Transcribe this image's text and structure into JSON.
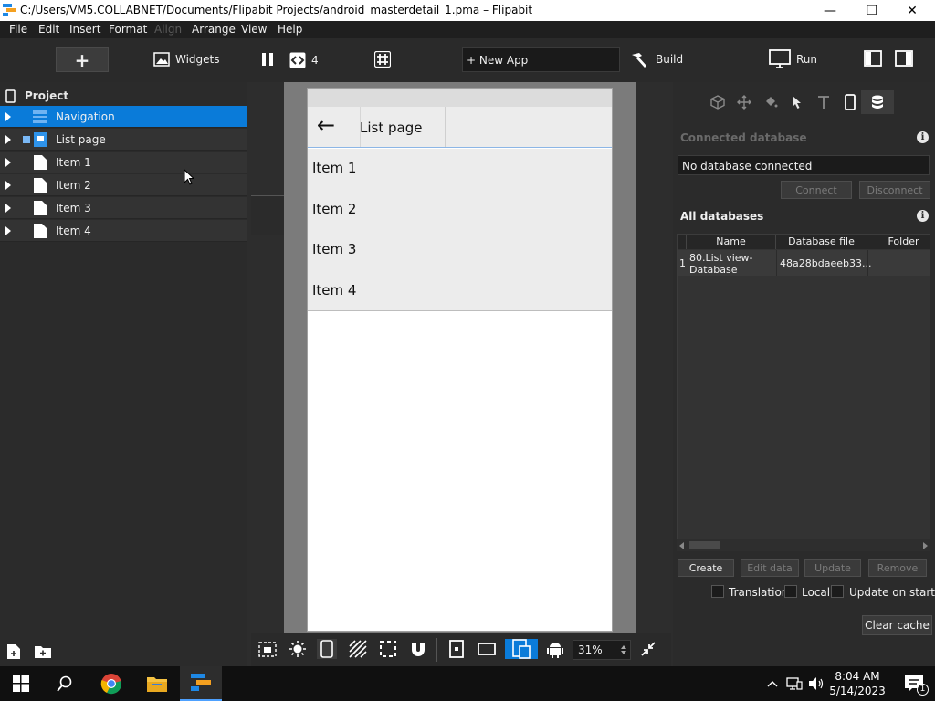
{
  "window": {
    "title": "C:/Users/VM5.COLLABNET/Documents/Flipabit Projects/android_masterdetail_1.pma – Flipabit",
    "minimize": "—",
    "restore": "❐",
    "close": "✕"
  },
  "menu": [
    "File",
    "Edit",
    "Insert",
    "Format",
    "Align",
    "Arrange",
    "View",
    "Help"
  ],
  "toolbar": {
    "add": "+",
    "widgets": "Widgets",
    "code_count": "4",
    "new_app": "+ New App",
    "build": "Build",
    "run": "Run"
  },
  "project": {
    "header": "Project",
    "items": [
      {
        "label": "Navigation",
        "icon": "navigation-icon",
        "selected": true
      },
      {
        "label": "List page",
        "icon": "page-icon",
        "selected": false
      },
      {
        "label": "Item 1",
        "icon": "document-icon",
        "selected": false
      },
      {
        "label": "Item 2",
        "icon": "document-icon",
        "selected": false
      },
      {
        "label": "Item 3",
        "icon": "document-icon",
        "selected": false
      },
      {
        "label": "Item 4",
        "icon": "document-icon",
        "selected": false
      }
    ]
  },
  "phone": {
    "appbar_title": "List page",
    "back": "←",
    "items": [
      "Item 1",
      "Item 2",
      "Item 3",
      "Item 4"
    ]
  },
  "canvas_toolbar": {
    "zoom": "31%"
  },
  "database": {
    "connected_title": "Connected database",
    "connected_value": "No database connected",
    "connect": "Connect",
    "disconnect": "Disconnect",
    "all_title": "All databases",
    "columns": [
      "Name",
      "Database file",
      "Folder"
    ],
    "rows": [
      {
        "num": "1",
        "name": "80.List view-Database",
        "file": "48a28bdaeeb33...",
        "folder": ""
      }
    ],
    "create": "Create",
    "edit_data": "Edit data",
    "update": "Update",
    "remove": "Remove",
    "translation": "Translation",
    "local": "Local",
    "update_on_startup": "Update on startup",
    "clear_cache": "Clear cache"
  },
  "taskbar": {
    "time": "8:04 AM",
    "date": "5/14/2023",
    "notifications": "1"
  },
  "colors": {
    "accent": "#0a7bd9",
    "panel": "#2b2b2b",
    "titlebar": "#ffffff"
  }
}
